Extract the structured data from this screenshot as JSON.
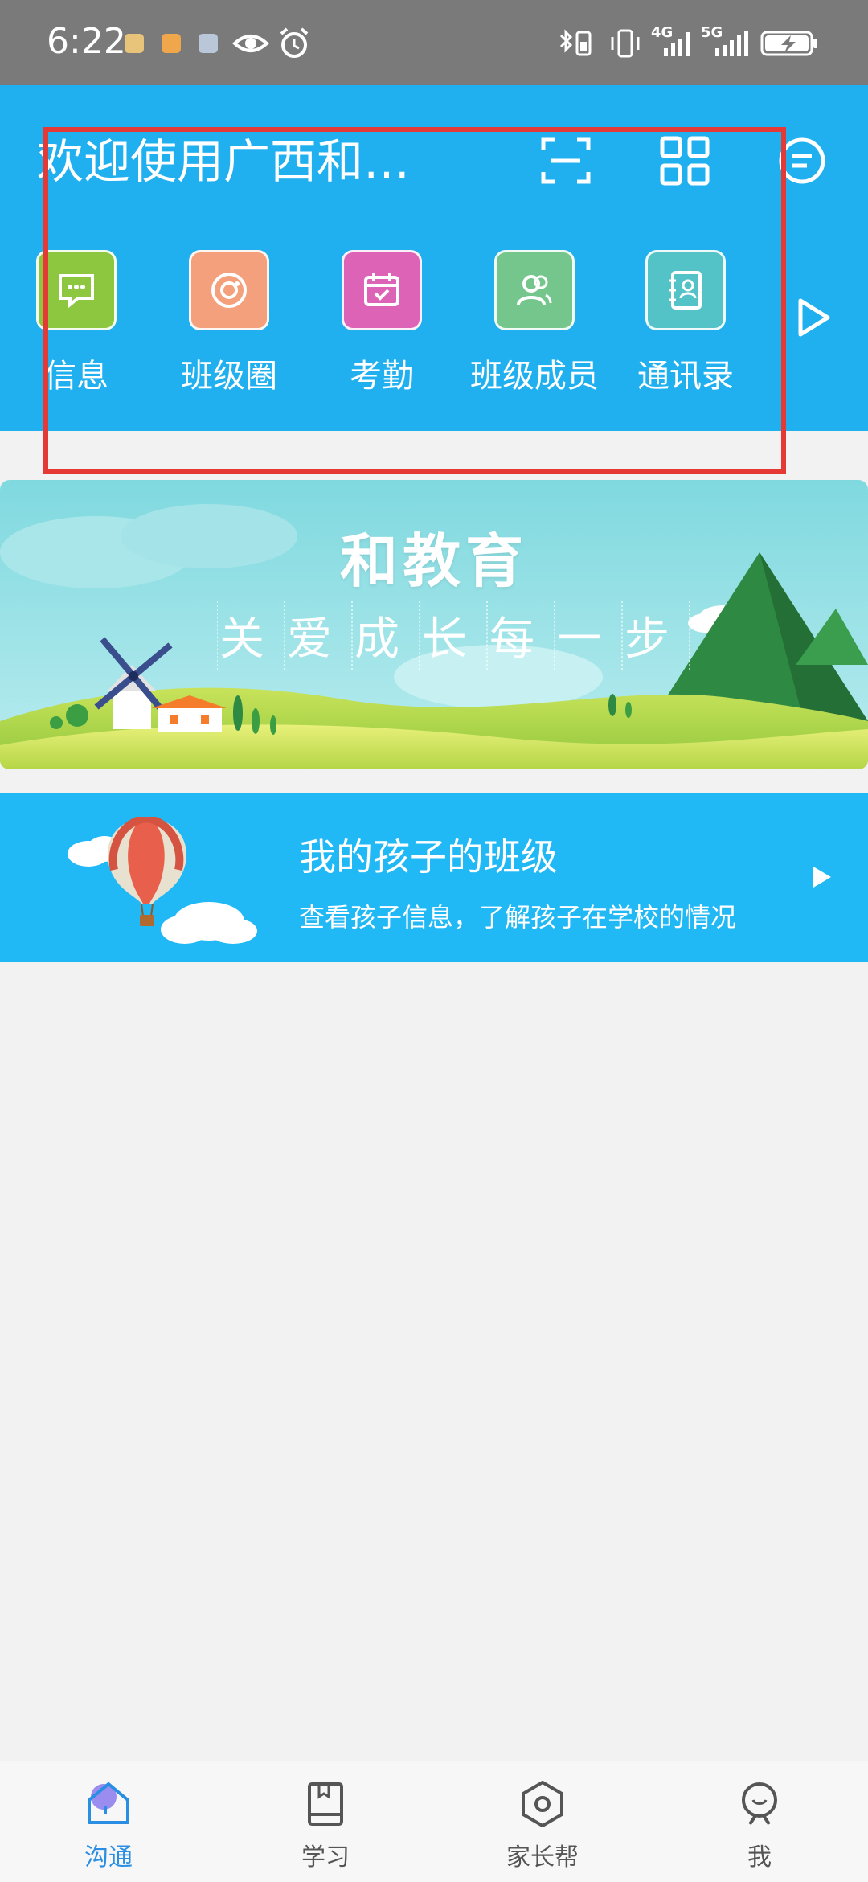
{
  "status_bar": {
    "time": "6:22",
    "network_1": "4G",
    "network_2": "5G"
  },
  "header": {
    "title": "欢迎使用广西和…",
    "icons": [
      "scan-icon",
      "grid-apps-icon",
      "menu-icon"
    ]
  },
  "quick_actions": [
    {
      "label": "信息",
      "icon": "message-icon",
      "color": "#8dc63f"
    },
    {
      "label": "班级圈",
      "icon": "class-circle-icon",
      "color": "#f4a07c"
    },
    {
      "label": "考勤",
      "icon": "attendance-icon",
      "color": "#dd63b6"
    },
    {
      "label": "班级成员",
      "icon": "members-icon",
      "color": "#74c68d"
    },
    {
      "label": "通讯录",
      "icon": "contacts-icon",
      "color": "#53c3c8"
    }
  ],
  "banner": {
    "title": "和教育",
    "subtitle_chars": [
      "关",
      "爱",
      "成",
      "长",
      "每",
      "一",
      "步"
    ]
  },
  "kids_class": {
    "title": "我的孩子的班级",
    "subtitle": "查看孩子信息，了解孩子在学校的情况"
  },
  "tab_bar": {
    "active": 0,
    "tabs": [
      {
        "label": "沟通",
        "icon": "home-icon"
      },
      {
        "label": "学习",
        "icon": "book-icon"
      },
      {
        "label": "家长帮",
        "icon": "hexagon-icon"
      },
      {
        "label": "我",
        "icon": "profile-icon"
      }
    ]
  },
  "colors": {
    "header_bg": "#21b0ef",
    "kids_bg": "#21b8f6",
    "active_tab": "#2a8ee3",
    "highlight_box": "#e53935"
  }
}
